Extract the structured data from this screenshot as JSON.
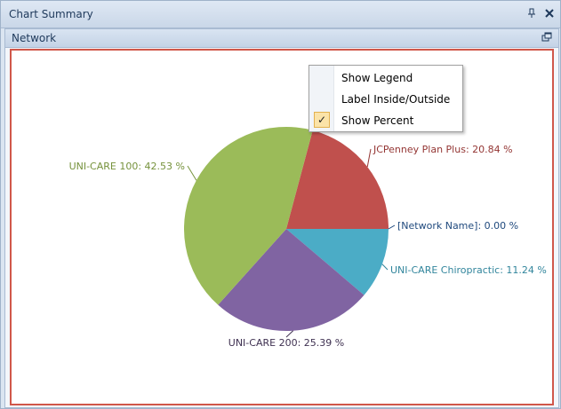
{
  "window": {
    "title": "Chart Summary",
    "pin_icon": "pin-icon",
    "close_icon": "close-icon"
  },
  "panel": {
    "title": "Network",
    "restore_icon": "restore-window-icon"
  },
  "context_menu": {
    "items": [
      {
        "label": "Show Legend",
        "checked": false
      },
      {
        "label": "Label Inside/Outside",
        "checked": false
      },
      {
        "label": "Show Percent",
        "checked": true
      }
    ]
  },
  "chart_data": {
    "type": "pie",
    "title": "",
    "slices": [
      {
        "label": "JCPenney Plan Plus: 20.84 %",
        "value": 20.84,
        "color": "#c0504d"
      },
      {
        "label": "[Network Name]: 0.00 %",
        "value": 0.0,
        "color": "#1f497d"
      },
      {
        "label": "UNI-CARE Chiropractic: 11.24 %",
        "value": 11.24,
        "color": "#4bacc6"
      },
      {
        "label": "UNI-CARE 200: 25.39 %",
        "value": 25.39,
        "color": "#8064a2"
      },
      {
        "label": "UNI-CARE 100: 42.53 %",
        "value": 42.53,
        "color": "#9bbb59"
      }
    ],
    "label_colors": [
      "#943634",
      "#1f497d",
      "#31859c",
      "#3f3151",
      "#76923c"
    ],
    "legend": "hidden"
  }
}
